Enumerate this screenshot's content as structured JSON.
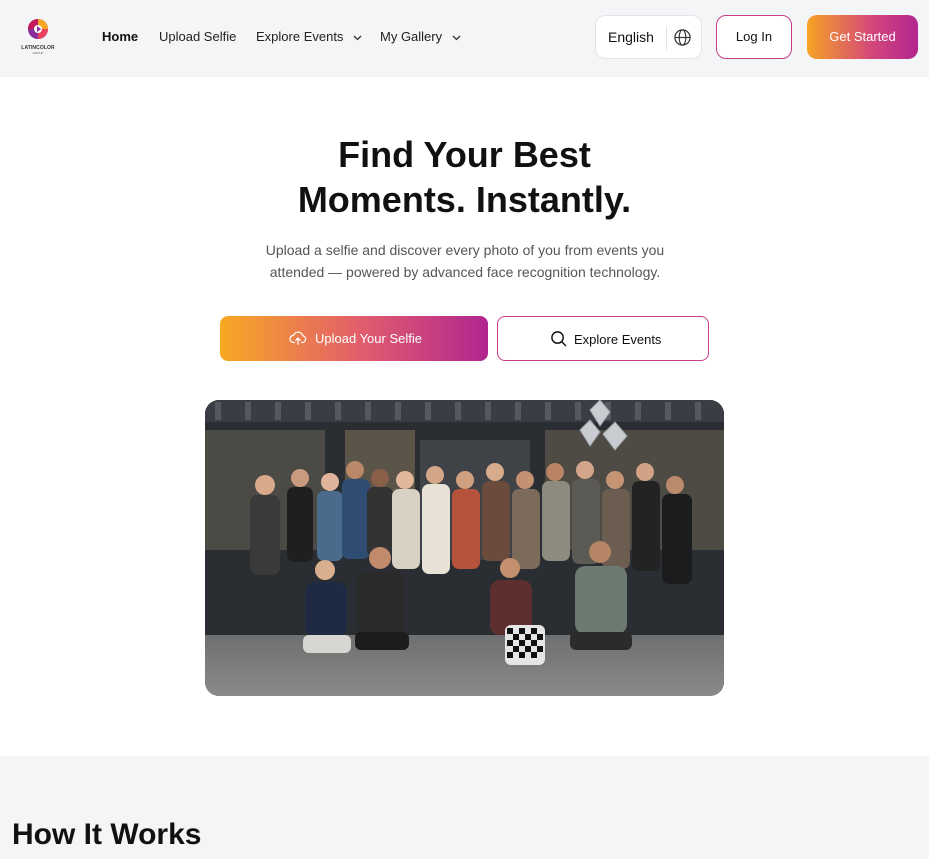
{
  "header": {
    "logo": {
      "name": "LATINCOLOR",
      "sub": "GROUP"
    },
    "nav": [
      {
        "label": "Home",
        "active": true,
        "has_dropdown": false
      },
      {
        "label": "Upload Selfie",
        "active": false,
        "has_dropdown": false
      },
      {
        "label": "Explore Events",
        "active": false,
        "has_dropdown": true
      },
      {
        "label": "My Gallery",
        "active": false,
        "has_dropdown": true
      }
    ],
    "language": {
      "label": "English",
      "icon": "globe-icon"
    },
    "login_label": "Log In",
    "get_started_label": "Get Started"
  },
  "hero": {
    "title_line1": "Find Your Best",
    "title_line2": "Moments. Instantly.",
    "subtitle": "Upload a selfie and discover every photo of you from events you attended — powered by advanced face recognition technology.",
    "upload_button": {
      "label": "Upload Your Selfie",
      "icon": "cloud-upload-icon"
    },
    "explore_button": {
      "label": "Explore Events",
      "icon": "search-icon"
    }
  },
  "how_it_works": {
    "title": "How It Works"
  },
  "colors": {
    "gradient_start": "#f7a325",
    "gradient_end": "#b0268f",
    "header_bg": "#f4f5f7",
    "accent_border": "#c93c8a"
  }
}
